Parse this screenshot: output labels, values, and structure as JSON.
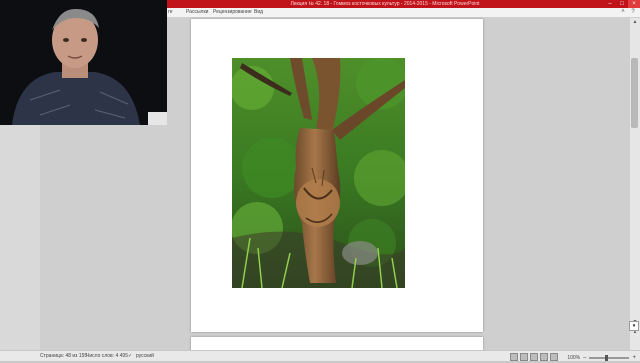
{
  "window": {
    "title": "Лекция № 42. 18 - Гоммоз косточковых культур - 2014-2015 - Microsoft PowerPoint"
  },
  "ribbon": {
    "tabs": [
      "ге",
      "Рассылки",
      "Рецензирование",
      "Вид"
    ]
  },
  "statusbar": {
    "page": "Страница: 48 из 155",
    "words": "Число слов: 4 495",
    "language": "русский",
    "zoom": "100%"
  },
  "icons": {
    "minimize": "minimize-icon",
    "maximize": "maximize-icon",
    "close": "close-icon",
    "help": "help-icon"
  }
}
